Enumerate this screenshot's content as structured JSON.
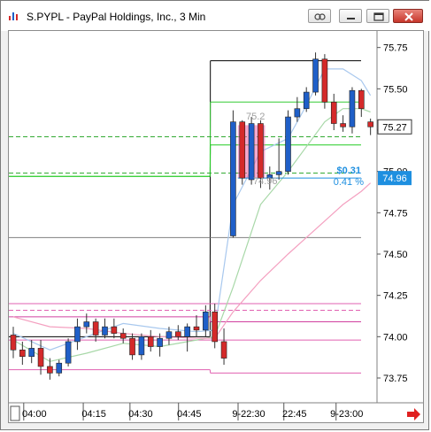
{
  "window": {
    "title": "S.PYPL - PayPal Holdings, Inc., 3 Min"
  },
  "colors": {
    "up": "#1f5fc8",
    "down": "#d42a2a",
    "accent": "#1e8fe0"
  },
  "icons": [
    "link-icon",
    "minimize-icon",
    "restore-icon",
    "close-icon",
    "arrow-right-icon"
  ],
  "chart_data": {
    "type": "candlestick",
    "ylim": [
      73.6,
      75.85
    ],
    "y_ticks": [
      "75.75",
      "75.50",
      "75.25",
      "75.00",
      "74.75",
      "74.50",
      "74.25",
      "74.00",
      "73.75"
    ],
    "y_tick_values": [
      75.75,
      75.5,
      75.25,
      75.0,
      74.75,
      74.5,
      74.25,
      74.0,
      73.75
    ],
    "x_tick_labels": [
      "04:00",
      "04:15",
      "04:30",
      "04:45",
      "9-22:30",
      "22:45",
      "9-23:00"
    ],
    "last_price_label": "75.27",
    "last_price": 75.27,
    "order_price_label": "74.96",
    "order_price": 74.96,
    "order_gain_label": "$0.31",
    "order_gain_pct_label": "0.41 %",
    "faded_label_upper": "75.2",
    "faded_label_lower": "74.96",
    "candles": [
      {
        "o": 74.01,
        "h": 74.06,
        "l": 73.87,
        "c": 73.92
      },
      {
        "o": 73.92,
        "h": 73.97,
        "l": 73.83,
        "c": 73.88
      },
      {
        "o": 73.88,
        "h": 73.98,
        "l": 73.84,
        "c": 73.93
      },
      {
        "o": 73.93,
        "h": 73.98,
        "l": 73.77,
        "c": 73.82
      },
      {
        "o": 73.82,
        "h": 73.87,
        "l": 73.74,
        "c": 73.78
      },
      {
        "o": 73.78,
        "h": 73.86,
        "l": 73.76,
        "c": 73.84
      },
      {
        "o": 73.84,
        "h": 73.99,
        "l": 73.82,
        "c": 73.97
      },
      {
        "o": 73.97,
        "h": 74.11,
        "l": 73.92,
        "c": 74.06
      },
      {
        "o": 74.06,
        "h": 74.14,
        "l": 74.02,
        "c": 74.09
      },
      {
        "o": 74.09,
        "h": 74.11,
        "l": 73.97,
        "c": 74.01
      },
      {
        "o": 74.01,
        "h": 74.11,
        "l": 73.99,
        "c": 74.06
      },
      {
        "o": 74.06,
        "h": 74.11,
        "l": 73.99,
        "c": 74.02
      },
      {
        "o": 74.02,
        "h": 74.05,
        "l": 73.96,
        "c": 73.99
      },
      {
        "o": 73.99,
        "h": 74.02,
        "l": 73.86,
        "c": 73.89
      },
      {
        "o": 73.89,
        "h": 74.02,
        "l": 73.86,
        "c": 74.0
      },
      {
        "o": 74.0,
        "h": 74.04,
        "l": 73.91,
        "c": 73.94
      },
      {
        "o": 73.94,
        "h": 74.02,
        "l": 73.88,
        "c": 73.99
      },
      {
        "o": 73.99,
        "h": 74.06,
        "l": 73.95,
        "c": 74.03
      },
      {
        "o": 74.03,
        "h": 74.07,
        "l": 73.98,
        "c": 74.0
      },
      {
        "o": 74.0,
        "h": 74.08,
        "l": 73.91,
        "c": 74.06
      },
      {
        "o": 74.06,
        "h": 74.13,
        "l": 74.0,
        "c": 74.04
      },
      {
        "o": 74.04,
        "h": 74.19,
        "l": 74.0,
        "c": 74.15
      },
      {
        "o": 74.15,
        "h": 74.2,
        "l": 73.93,
        "c": 73.97
      },
      {
        "o": 73.97,
        "h": 74.05,
        "l": 73.83,
        "c": 73.87
      },
      {
        "o": 74.61,
        "h": 75.37,
        "l": 74.6,
        "c": 75.3
      },
      {
        "o": 75.3,
        "h": 75.31,
        "l": 74.92,
        "c": 74.96
      },
      {
        "o": 74.95,
        "h": 75.33,
        "l": 74.92,
        "c": 75.29
      },
      {
        "o": 75.29,
        "h": 75.31,
        "l": 74.9,
        "c": 74.96
      },
      {
        "o": 74.96,
        "h": 75.03,
        "l": 74.89,
        "c": 74.98
      },
      {
        "o": 74.98,
        "h": 75.2,
        "l": 74.95,
        "c": 75.0
      },
      {
        "o": 75.0,
        "h": 75.37,
        "l": 74.98,
        "c": 75.33
      },
      {
        "o": 75.33,
        "h": 75.45,
        "l": 75.3,
        "c": 75.38
      },
      {
        "o": 75.38,
        "h": 75.51,
        "l": 75.36,
        "c": 75.48
      },
      {
        "o": 75.48,
        "h": 75.72,
        "l": 75.46,
        "c": 75.68
      },
      {
        "o": 75.68,
        "h": 75.71,
        "l": 75.38,
        "c": 75.42
      },
      {
        "o": 75.42,
        "h": 75.47,
        "l": 75.25,
        "c": 75.29
      },
      {
        "o": 75.29,
        "h": 75.34,
        "l": 75.24,
        "c": 75.27
      },
      {
        "o": 75.27,
        "h": 75.51,
        "l": 75.23,
        "c": 75.49
      },
      {
        "o": 75.49,
        "h": 75.5,
        "l": 75.33,
        "c": 75.38
      },
      {
        "o": 75.3,
        "h": 75.32,
        "l": 75.22,
        "c": 75.27
      }
    ],
    "hlines": [
      {
        "name": "black-level-line",
        "color": "#000000",
        "dash": false,
        "segments": [
          [
            0,
            21,
            74.0
          ],
          [
            22,
            39,
            75.67
          ]
        ]
      },
      {
        "name": "green-upper-line",
        "color": "#33cc33",
        "dash": false,
        "segments": [
          [
            0,
            21,
            74.97
          ],
          [
            22,
            39,
            75.42
          ]
        ]
      },
      {
        "name": "green-dashed-upper",
        "color": "#33aa33",
        "dash": true,
        "segments": [
          [
            0,
            39,
            75.21
          ]
        ]
      },
      {
        "name": "green-middle-line",
        "color": "#22cc22",
        "dash": false,
        "segments": [
          [
            0,
            21,
            74.97
          ],
          [
            22,
            39,
            75.16
          ]
        ]
      },
      {
        "name": "green-dashed-lower",
        "color": "#33aa33",
        "dash": true,
        "segments": [
          [
            0,
            39,
            74.99
          ]
        ]
      },
      {
        "name": "gray-lower-line",
        "color": "#808080",
        "dash": false,
        "segments": [
          [
            0,
            21,
            74.6
          ],
          [
            22,
            39,
            74.6
          ]
        ]
      },
      {
        "name": "pink-upper-line",
        "color": "#e060b0",
        "dash": false,
        "segments": [
          [
            0,
            39,
            74.2
          ]
        ]
      },
      {
        "name": "pink-dashed-upper",
        "color": "#e060b0",
        "dash": true,
        "segments": [
          [
            0,
            39,
            74.16
          ]
        ]
      },
      {
        "name": "pink-mid-line",
        "color": "#d040a0",
        "dash": false,
        "segments": [
          [
            0,
            21,
            74.12
          ],
          [
            22,
            39,
            74.09
          ]
        ]
      },
      {
        "name": "pink-lower-line",
        "color": "#e060b0",
        "dash": false,
        "segments": [
          [
            0,
            39,
            73.98
          ]
        ]
      },
      {
        "name": "pink-bottom-line",
        "color": "#e060b0",
        "dash": false,
        "segments": [
          [
            0,
            21,
            73.8
          ],
          [
            22,
            39,
            73.78
          ]
        ]
      }
    ],
    "series": [
      {
        "color": "#a8c8ee",
        "points": [
          [
            0,
            74.02
          ],
          [
            4,
            73.92
          ],
          [
            8,
            74.0
          ],
          [
            12,
            74.08
          ],
          [
            16,
            74.05
          ],
          [
            20,
            74.03
          ],
          [
            22,
            74.04
          ],
          [
            24,
            74.8
          ],
          [
            27,
            75.12
          ],
          [
            30,
            75.2
          ],
          [
            32,
            75.4
          ],
          [
            34,
            75.62
          ],
          [
            36,
            75.62
          ],
          [
            38,
            75.55
          ],
          [
            39,
            75.46
          ]
        ]
      },
      {
        "color": "#a8d8a8",
        "points": [
          [
            0,
            73.98
          ],
          [
            4,
            73.85
          ],
          [
            8,
            73.9
          ],
          [
            12,
            73.96
          ],
          [
            16,
            73.94
          ],
          [
            20,
            73.98
          ],
          [
            22,
            74.0
          ],
          [
            24,
            74.3
          ],
          [
            27,
            74.8
          ],
          [
            30,
            75.0
          ],
          [
            32,
            75.15
          ],
          [
            34,
            75.3
          ],
          [
            36,
            75.38
          ],
          [
            38,
            75.38
          ],
          [
            39,
            75.36
          ]
        ]
      },
      {
        "color": "#f4a0c0",
        "points": [
          [
            0,
            74.12
          ],
          [
            4,
            74.06
          ],
          [
            8,
            74.05
          ],
          [
            12,
            74.02
          ],
          [
            16,
            74.0
          ],
          [
            20,
            73.99
          ],
          [
            22,
            73.99
          ],
          [
            24,
            74.15
          ],
          [
            27,
            74.34
          ],
          [
            30,
            74.5
          ],
          [
            32,
            74.6
          ],
          [
            34,
            74.7
          ],
          [
            36,
            74.8
          ],
          [
            38,
            74.88
          ],
          [
            39,
            74.93
          ]
        ]
      }
    ],
    "order_zone": {
      "x0": 25,
      "x1": 27,
      "y_top": 75.28,
      "y_bottom": 74.96
    }
  }
}
